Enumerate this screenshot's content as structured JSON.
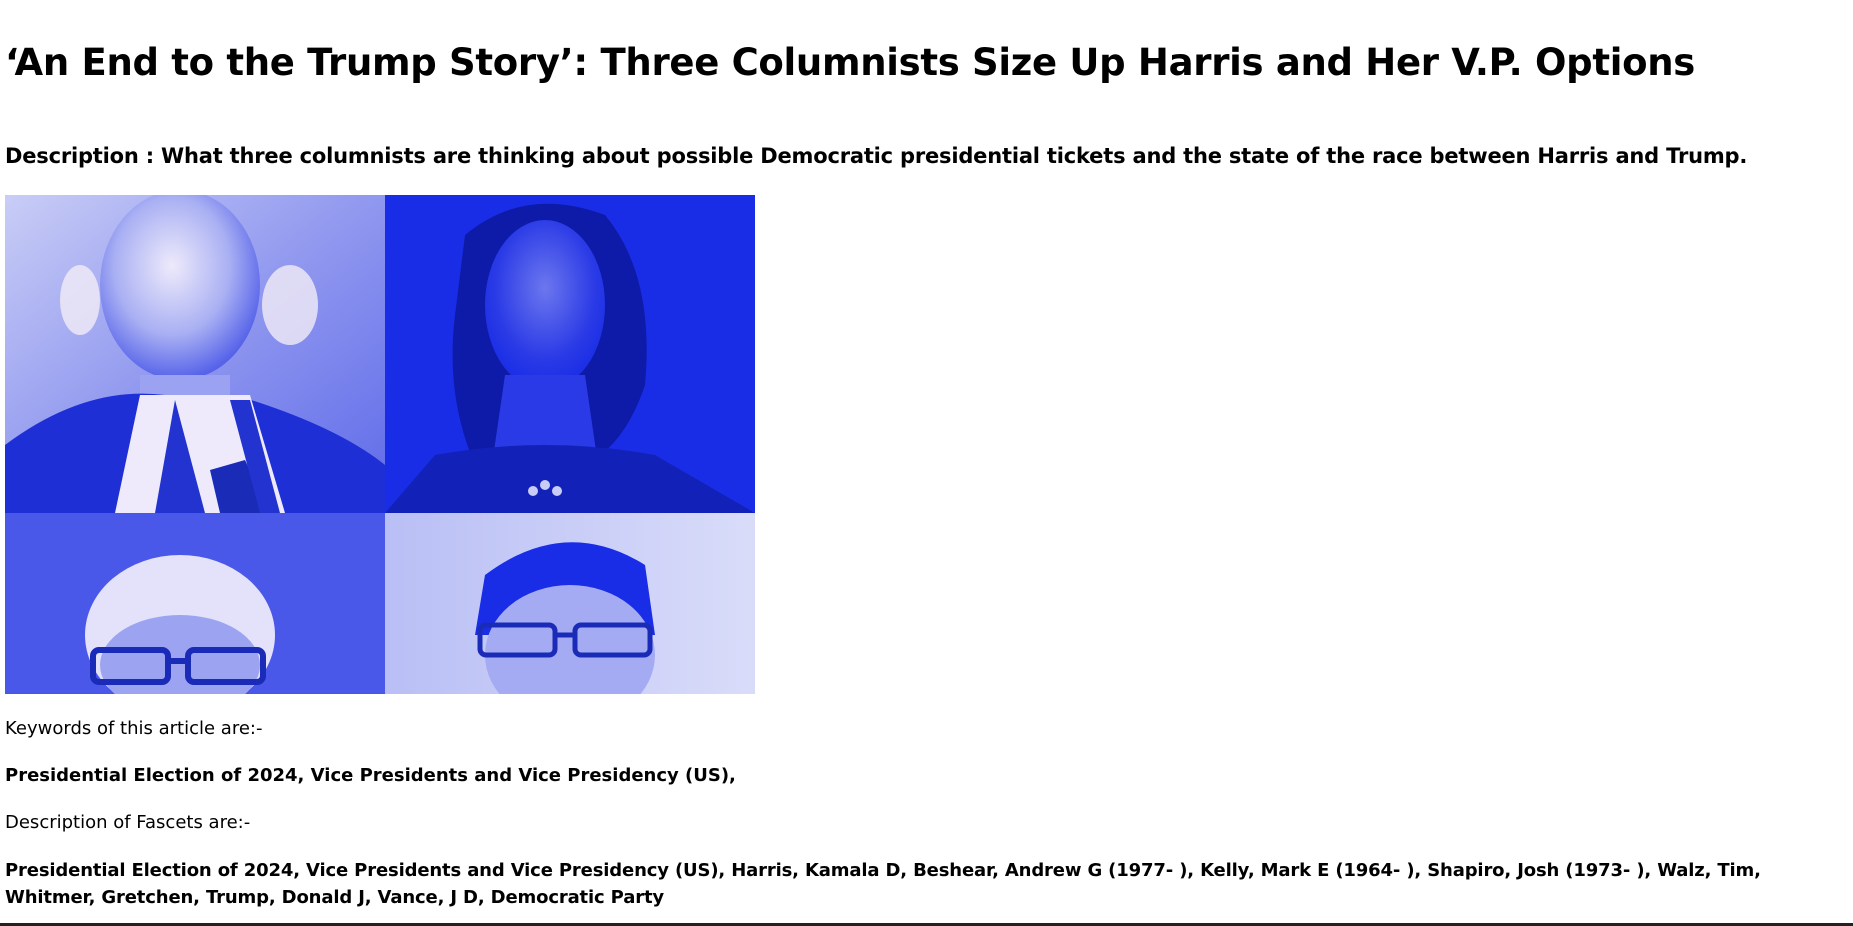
{
  "article": {
    "title": "‘An End to the Trump Story’: Three Columnists Size Up Harris and Her V.P. Options",
    "description": "Description : What three columnists are thinking about possible Democratic presidential tickets and the state of the race between Harris and Trump."
  },
  "image": {
    "alt": "Four-panel duotone blue photo collage of politicians",
    "tint_color": "#1a2de6",
    "light_color": "#f3ecf6"
  },
  "keywords": {
    "heading": "Keywords of this article are:-",
    "items": "Presidential Election of 2024, Vice Presidents and Vice Presidency (US),"
  },
  "facets": {
    "heading": "Description of Fascets are:-",
    "items": "Presidential Election of 2024, Vice Presidents and Vice Presidency (US), Harris, Kamala D, Beshear, Andrew G (1977- ), Kelly, Mark E (1964- ), Shapiro, Josh (1973- ), Walz, Tim, Whitmer, Gretchen, Trump, Donald J, Vance, J D, Democratic Party"
  }
}
